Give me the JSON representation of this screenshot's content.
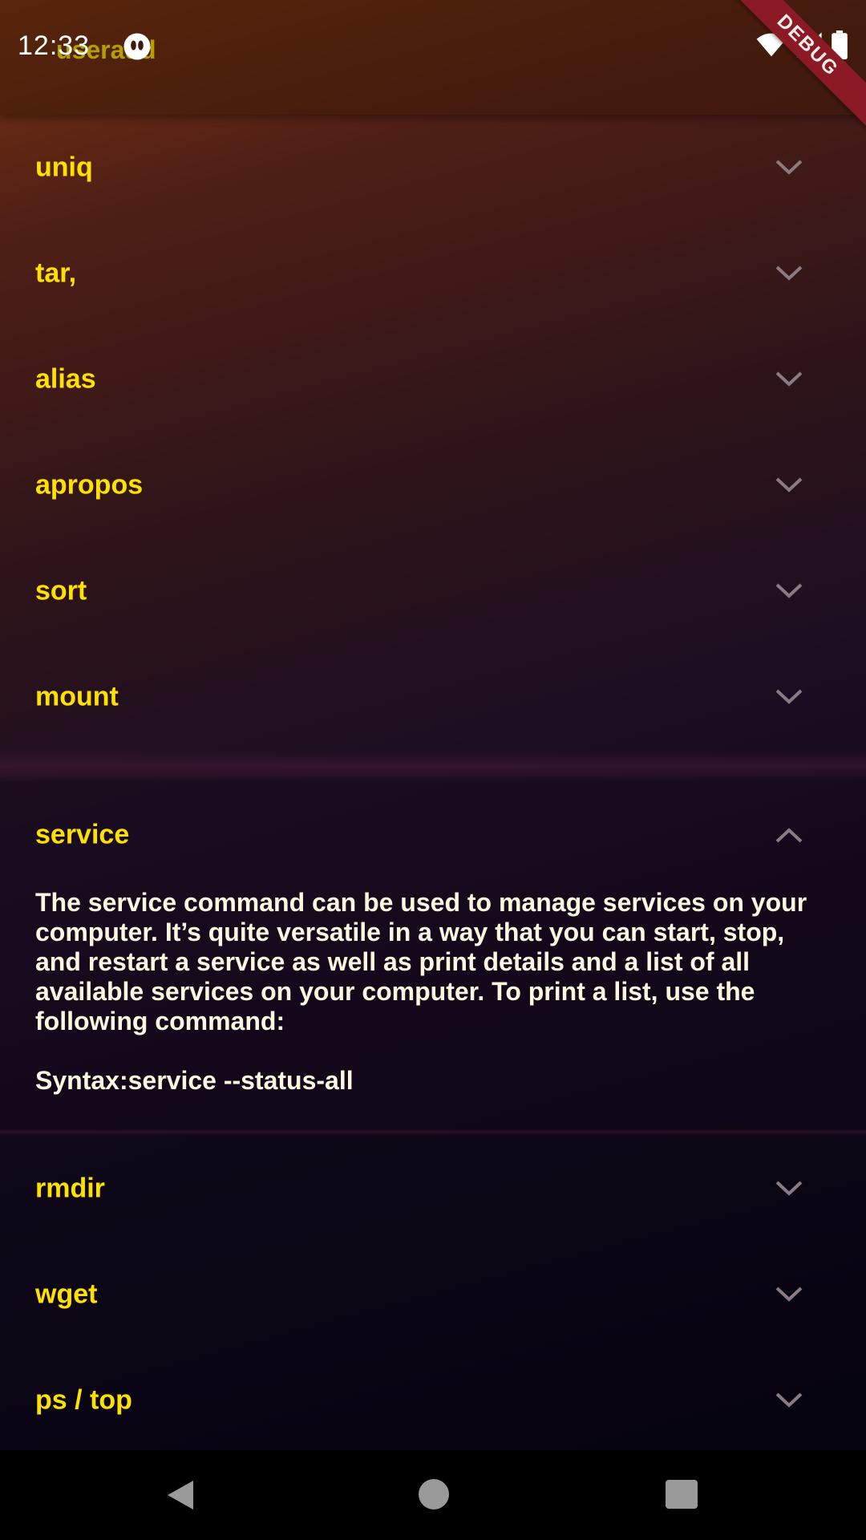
{
  "status_bar": {
    "time": "12:33",
    "icons": [
      "notification-icon",
      "wifi-icon",
      "signal-icon",
      "battery-icon"
    ]
  },
  "app_bar": {
    "title": "useradd"
  },
  "debug_banner": "DEBUG",
  "colors": {
    "label": "#ffe100",
    "body_text": "#fff6e0",
    "chevron": "#8a7a82"
  },
  "commands_before": [
    {
      "label": "uniq"
    },
    {
      "label": "tar,"
    },
    {
      "label": "alias"
    },
    {
      "label": "apropos"
    },
    {
      "label": "sort"
    },
    {
      "label": "mount"
    }
  ],
  "expanded_item": {
    "label": "service",
    "description": "The service command can be used to manage services on your computer. It’s quite versatile in a way that you can start, stop, and restart a service as well as print details and a list of all available services on your computer. To print a list, use the following command:",
    "syntax": "Syntax:service --status-all"
  },
  "commands_after": [
    {
      "label": "rmdir"
    },
    {
      "label": "wget"
    },
    {
      "label": "ps / top"
    }
  ],
  "nav_bar": {
    "buttons": [
      "back-icon",
      "home-icon",
      "recents-icon"
    ]
  }
}
